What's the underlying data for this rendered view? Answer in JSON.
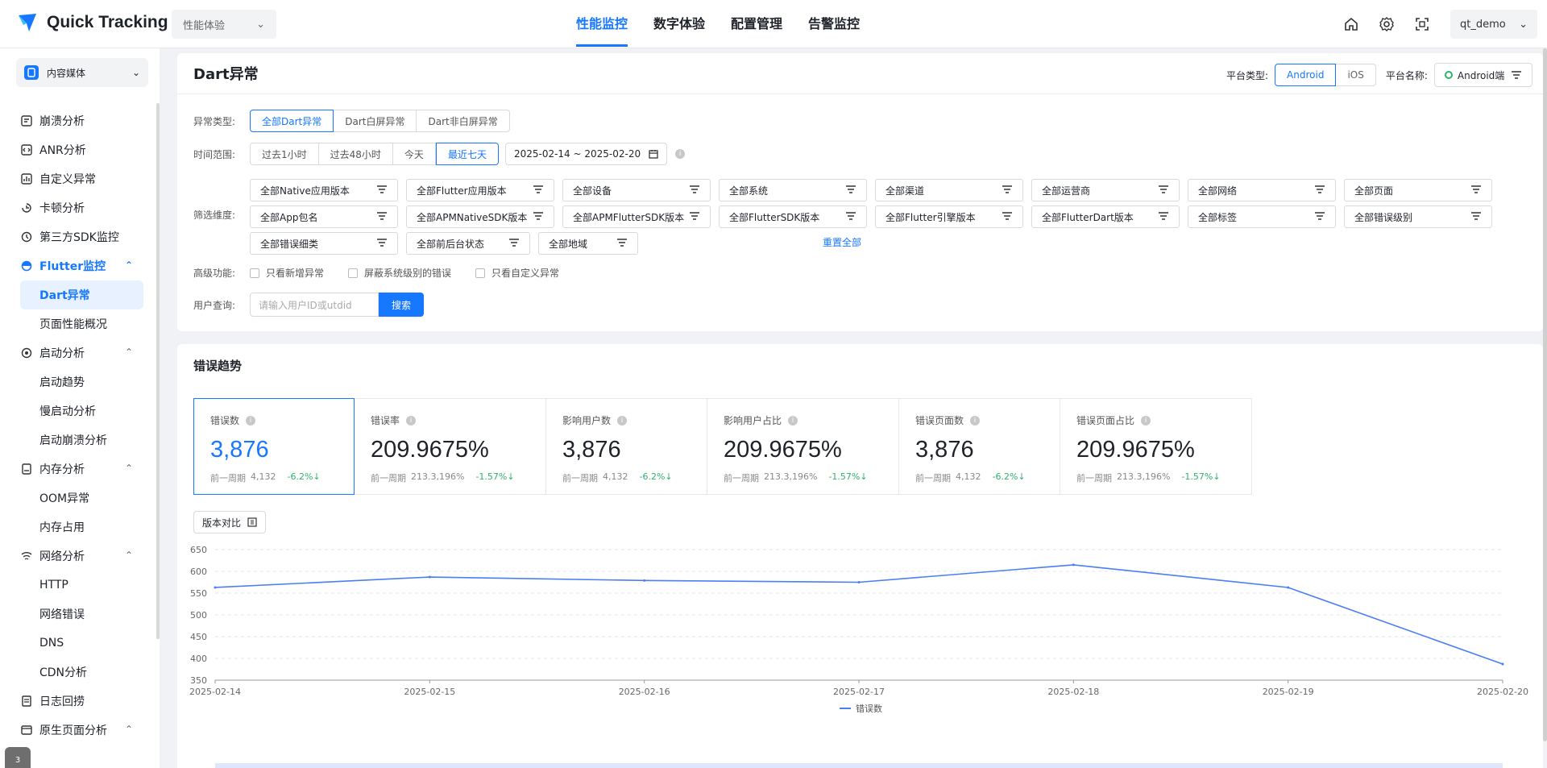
{
  "app": {
    "logo_text": "Quick Tracking",
    "product_select": "性能体验",
    "user": "qt_demo"
  },
  "topnav": [
    {
      "label": "性能监控",
      "active": true
    },
    {
      "label": "数字体验",
      "active": false
    },
    {
      "label": "配置管理",
      "active": false
    },
    {
      "label": "告警监控",
      "active": false
    }
  ],
  "top_icons": [
    "home-icon",
    "gear-icon",
    "scan-icon"
  ],
  "sidebar": {
    "app_select": "内容媒体",
    "items": [
      {
        "label": "崩溃分析",
        "type": "item",
        "icon": "crash-icon"
      },
      {
        "label": "ANR分析",
        "type": "item",
        "icon": "code-icon"
      },
      {
        "label": "自定义异常",
        "type": "item",
        "icon": "chart-icon"
      },
      {
        "label": "卡顿分析",
        "type": "item",
        "icon": "lag-icon"
      },
      {
        "label": "第三方SDK监控",
        "type": "item",
        "icon": "sdk-icon"
      },
      {
        "label": "Flutter监控",
        "type": "group-open",
        "icon": "flutter-icon"
      },
      {
        "label": "Dart异常",
        "type": "sub-active"
      },
      {
        "label": "页面性能概况",
        "type": "sub"
      },
      {
        "label": "启动分析",
        "type": "group",
        "icon": "startup-icon"
      },
      {
        "label": "启动趋势",
        "type": "sub"
      },
      {
        "label": "慢启动分析",
        "type": "sub"
      },
      {
        "label": "启动崩溃分析",
        "type": "sub"
      },
      {
        "label": "内存分析",
        "type": "group",
        "icon": "memory-icon"
      },
      {
        "label": "OOM异常",
        "type": "sub"
      },
      {
        "label": "内存占用",
        "type": "sub"
      },
      {
        "label": "网络分析",
        "type": "group",
        "icon": "wifi-icon"
      },
      {
        "label": "HTTP",
        "type": "sub"
      },
      {
        "label": "网络错误",
        "type": "sub"
      },
      {
        "label": "DNS",
        "type": "sub"
      },
      {
        "label": "CDN分析",
        "type": "sub"
      },
      {
        "label": "日志回捞",
        "type": "item",
        "icon": "log-icon"
      },
      {
        "label": "原生页面分析",
        "type": "group",
        "icon": "page-icon"
      }
    ],
    "float_badge": "3"
  },
  "page": {
    "title": "Dart异常",
    "platform_type_label": "平台类型:",
    "platform_options": [
      {
        "label": "Android",
        "active": true
      },
      {
        "label": "iOS",
        "active": false
      }
    ],
    "platform_name_label": "平台名称:",
    "platform_name_value": "Android端"
  },
  "filters": {
    "error_type_label": "异常类型:",
    "error_types": [
      {
        "label": "全部Dart异常",
        "active": true
      },
      {
        "label": "Dart白屏异常",
        "active": false
      },
      {
        "label": "Dart非白屏异常",
        "active": false
      }
    ],
    "time_label": "时间范围:",
    "time_options": [
      {
        "label": "过去1小时",
        "active": false
      },
      {
        "label": "过去48小时",
        "active": false
      },
      {
        "label": "今天",
        "active": false
      },
      {
        "label": "最近七天",
        "active": true
      }
    ],
    "date_range": "2025-02-14 ~ 2025-02-20",
    "dim_label": "筛选维度:",
    "dims": [
      "全部Native应用版本",
      "全部Flutter应用版本",
      "全部设备",
      "全部系统",
      "全部渠道",
      "全部运营商",
      "全部网络",
      "全部页面",
      "全部App包名",
      "全部APMNativeSDK版本",
      "全部APMFlutterSDK版本",
      "全部FlutterSDK版本",
      "全部Flutter引擎版本",
      "全部FlutterDart版本",
      "全部标签",
      "全部错误级别",
      "全部错误细类",
      "全部前后台状态",
      "全部地域"
    ],
    "reset": "重置全部",
    "advanced_label": "高级功能:",
    "checks": [
      "只看新增异常",
      "屏蔽系统级别的错误",
      "只看自定义异常"
    ],
    "user_label": "用户查询:",
    "user_placeholder": "请输入用户ID或utdid",
    "search_btn": "搜索"
  },
  "trend": {
    "title": "错误趋势",
    "metrics": [
      {
        "label": "错误数",
        "value": "3,876",
        "prev_label": "前一周期",
        "prev": "4,132",
        "change": "-6.2%",
        "active": true
      },
      {
        "label": "错误率",
        "value": "209.9675%",
        "prev_label": "前一周期",
        "prev": "213.3,196%",
        "change": "-1.57%",
        "active": false
      },
      {
        "label": "影响用户数",
        "value": "3,876",
        "prev_label": "前一周期",
        "prev": "4,132",
        "change": "-6.2%",
        "active": false
      },
      {
        "label": "影响用户占比",
        "value": "209.9675%",
        "prev_label": "前一周期",
        "prev": "213.3,196%",
        "change": "-1.57%",
        "active": false
      },
      {
        "label": "错误页面数",
        "value": "3,876",
        "prev_label": "前一周期",
        "prev": "4,132",
        "change": "-6.2%",
        "active": false
      },
      {
        "label": "错误页面占比",
        "value": "209.9675%",
        "prev_label": "前一周期",
        "prev": "213.3,196%",
        "change": "-1.57%",
        "active": false
      }
    ],
    "version_btn": "版本对比"
  },
  "chart_data": {
    "type": "line",
    "x": [
      "2025-02-14",
      "2025-02-15",
      "2025-02-16",
      "2025-02-17",
      "2025-02-18",
      "2025-02-19",
      "2025-02-20"
    ],
    "series": [
      {
        "name": "错误数",
        "values": [
          563,
          587,
          579,
          575,
          615,
          563,
          387
        ],
        "color": "#4a7ef5"
      }
    ],
    "yticks": [
      350,
      400,
      450,
      500,
      550,
      600,
      650
    ],
    "ylim": [
      350,
      650
    ],
    "grid": true,
    "legend": "bottom"
  }
}
